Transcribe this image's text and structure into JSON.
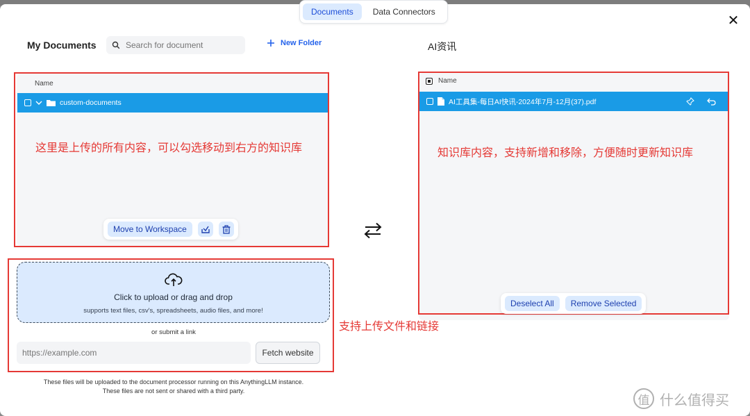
{
  "tabs": [
    {
      "label": "Documents",
      "active": true
    },
    {
      "label": "Data Connectors",
      "active": false
    }
  ],
  "left": {
    "title": "My Documents",
    "search_placeholder": "Search for document",
    "new_folder_label": "New Folder",
    "column_name": "Name",
    "folder_name": "custom-documents",
    "annotation": "这里是上传的所有内容，可以勾选移动到右方的知识库",
    "move_label": "Move to Workspace"
  },
  "upload": {
    "title": "Click to upload or drag and drop",
    "subtitle": "supports text files, csv's, spreadsheets, audio files, and more!",
    "or_submit": "or submit a link",
    "url_placeholder": "https://example.com",
    "fetch_label": "Fetch website",
    "annotation": "支持上传文件和链接",
    "disclaimer_1": "These files will be uploaded to the document processor running on this AnythingLLM instance.",
    "disclaimer_2": "These files are not sent or shared with a third party."
  },
  "right": {
    "title": "AI资讯",
    "column_name": "Name",
    "file_name": "AI工具集-每日AI快讯-2024年7月-12月(37).pdf",
    "annotation": "知识库内容，支持新增和移除，方便随时更新知识库",
    "deselect_label": "Deselect All",
    "remove_label": "Remove Selected"
  },
  "watermark": {
    "text": "什么值得买"
  },
  "colors": {
    "accent": "#1a9be6",
    "annotation": "#e53935",
    "button_bg": "#dbeafe"
  }
}
